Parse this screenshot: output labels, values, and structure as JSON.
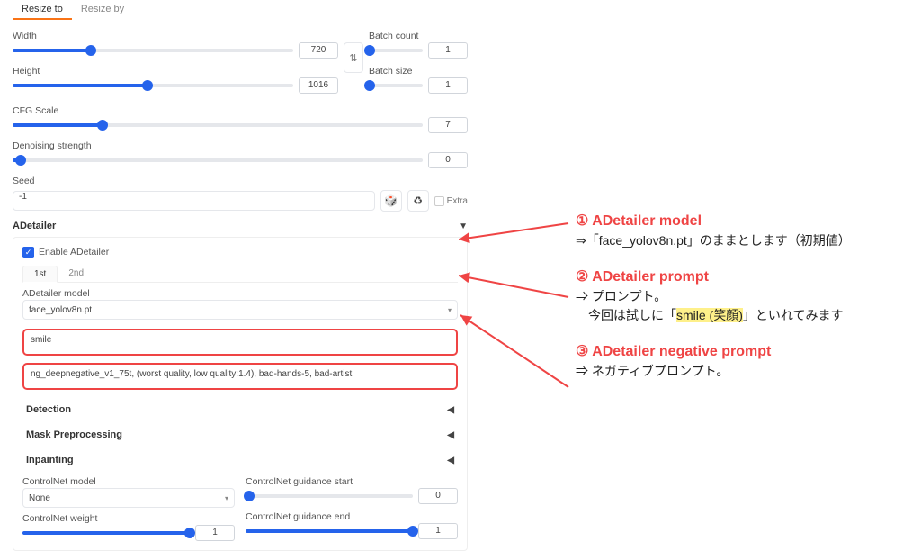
{
  "resize_tabs": {
    "to": "Resize to",
    "by": "Resize by"
  },
  "width": {
    "label": "Width",
    "value": "720",
    "pct": 28
  },
  "height": {
    "label": "Height",
    "value": "1016",
    "pct": 48
  },
  "batch_count": {
    "label": "Batch count",
    "value": "1",
    "pct": 2
  },
  "batch_size": {
    "label": "Batch size",
    "value": "1",
    "pct": 2
  },
  "cfg": {
    "label": "CFG Scale",
    "value": "7",
    "pct": 22
  },
  "denoise": {
    "label": "Denoising strength",
    "value": "0",
    "pct": 2
  },
  "seed": {
    "label": "Seed",
    "value": "-1",
    "extra": "Extra"
  },
  "adet": {
    "title": "ADetailer",
    "enable": "Enable ADetailer",
    "tabs": {
      "t1": "1st",
      "t2": "2nd"
    },
    "model_label": "ADetailer model",
    "model_value": "face_yolov8n.pt",
    "prompt": "smile",
    "neg_prompt": "ng_deepnegative_v1_75t, (worst quality, low quality:1.4), bad-hands-5, bad-artist",
    "detection": "Detection",
    "mask": "Mask Preprocessing",
    "inpaint": "Inpainting",
    "cn_model": {
      "label": "ControlNet model",
      "value": "None"
    },
    "cn_weight": {
      "label": "ControlNet weight",
      "value": "1",
      "pct": 100
    },
    "cn_gstart": {
      "label": "ControlNet guidance start",
      "value": "0",
      "pct": 2
    },
    "cn_gend": {
      "label": "ControlNet guidance end",
      "value": "1",
      "pct": 100
    }
  },
  "annot": {
    "a1_title": "① ADetailer model",
    "a1_body": "⇒「face_yolov8n.pt」のままとします（初期値）",
    "a2_title": "② ADetailer prompt",
    "a2_body_pre": "⇒ プロンプト。\n　今回は試しに「",
    "a2_hl": "smile (笑顔)",
    "a2_body_post": "」といれてみます",
    "a3_title": "③ ADetailer negative prompt",
    "a3_body": "⇒ ネガティブプロンプト。"
  }
}
